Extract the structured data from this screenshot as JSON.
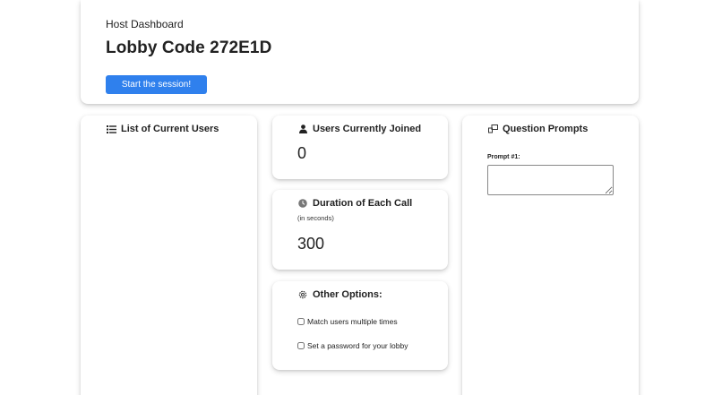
{
  "header": {
    "host_label": "Host Dashboard",
    "lobby_title": "Lobby Code 272E1D",
    "start_button": "Start the session!"
  },
  "users_list": {
    "title": "List of Current Users",
    "icon": "list-icon"
  },
  "users_joined": {
    "title": "Users Currently Joined",
    "icon": "user-icon",
    "count": "0"
  },
  "duration": {
    "title": "Duration of Each Call",
    "note": "(in seconds)",
    "icon": "clock-icon",
    "value": "300"
  },
  "options": {
    "title": "Other Options:",
    "icon": "gear-icon",
    "items": [
      {
        "label": "Match users multiple times",
        "checked": false
      },
      {
        "label": "Set a password for your lobby",
        "checked": false
      }
    ]
  },
  "prompts": {
    "title": "Question Prompts",
    "icon": "question-prompts-icon",
    "prompt_label": "Prompt #1:",
    "prompt_value": ""
  },
  "colors": {
    "accent": "#2f80ed"
  }
}
